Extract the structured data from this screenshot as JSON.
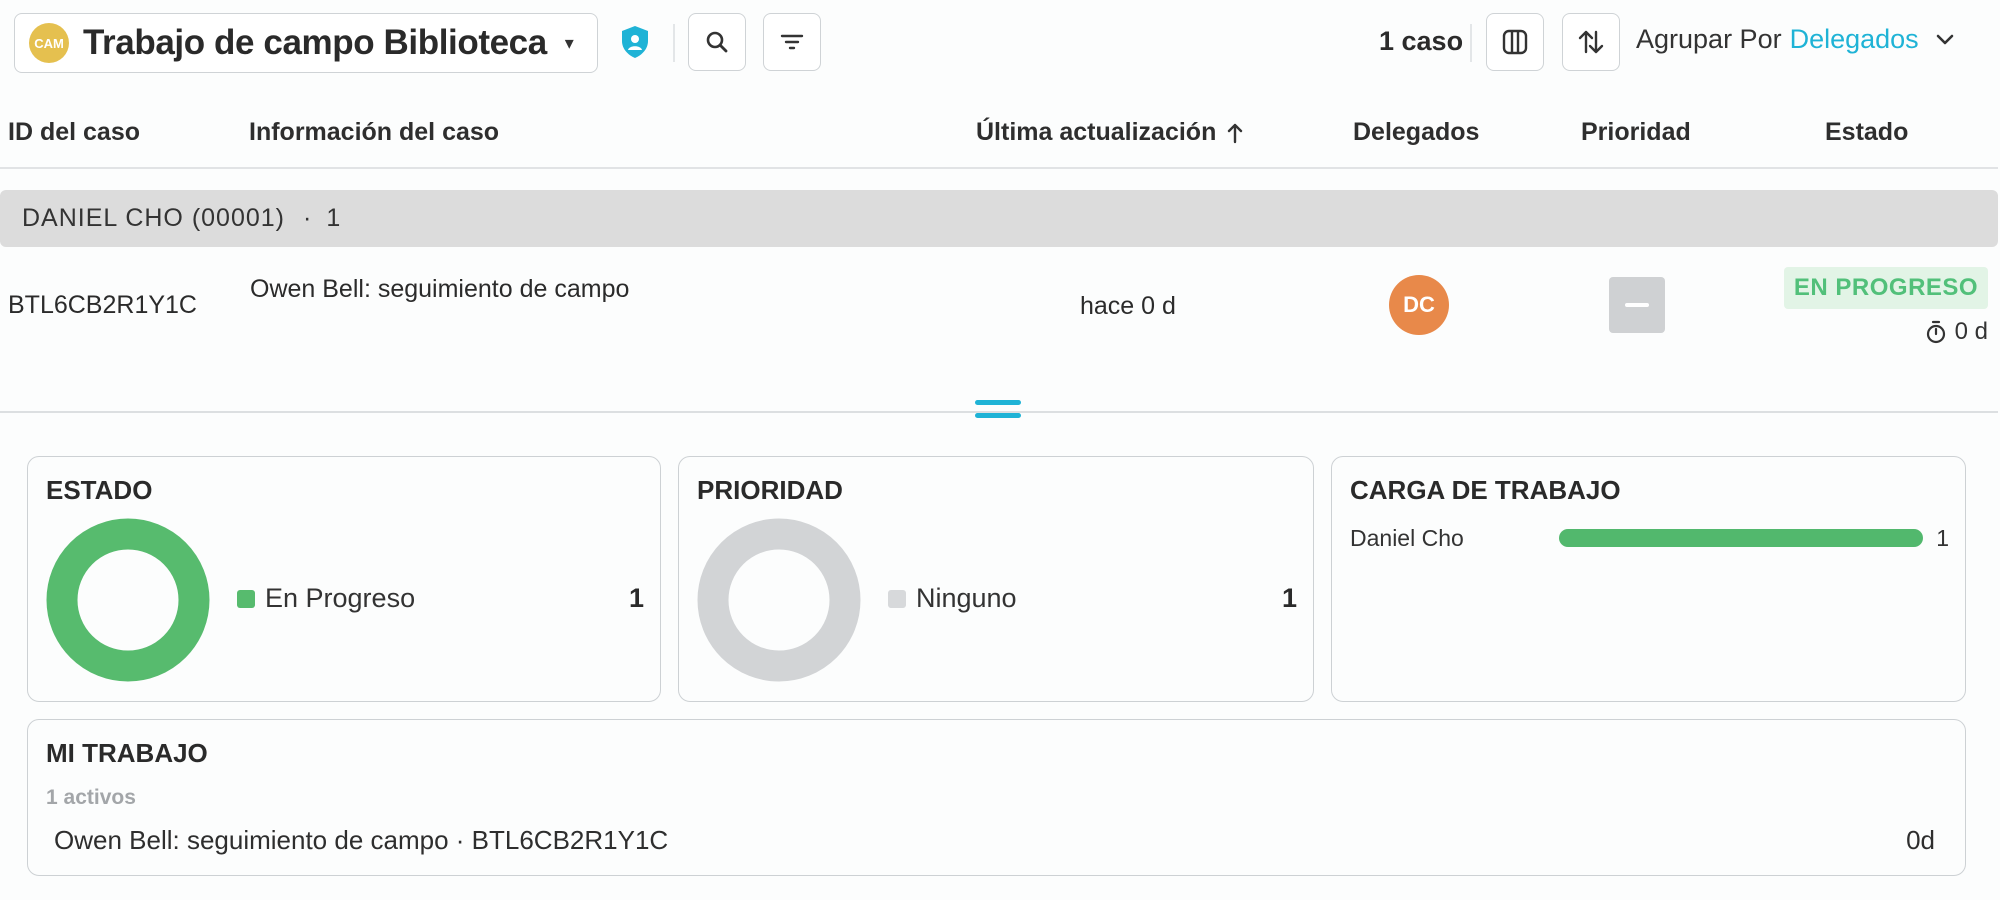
{
  "toolbar": {
    "project_avatar": "CAM",
    "project_title": "Trabajo de campo Biblioteca",
    "case_count": "1 caso",
    "group_by_label": "Agrupar Por",
    "group_by_value": "Delegados",
    "accent_color": "#1fb3d6"
  },
  "table": {
    "headers": {
      "id": "ID del caso",
      "info": "Información del caso",
      "updated": "Última actualización",
      "assignees": "Delegados",
      "priority": "Prioridad",
      "status": "Estado"
    },
    "sort_icon": "arrow-up-icon",
    "group": {
      "label": "DANIEL CHO (00001)",
      "separator": "·",
      "count": "1"
    },
    "rows": [
      {
        "id": "BTL6CB2R1Y1C",
        "info": "Owen Bell: seguimiento de campo",
        "updated": "hace 0 d",
        "assignee_initials": "DC",
        "priority": "—",
        "status": "EN PROGRESO",
        "timer": "0 d"
      }
    ]
  },
  "cards": {
    "estado": {
      "title": "ESTADO",
      "legend_label": "En Progreso",
      "legend_count": "1",
      "color": "#57bb6e"
    },
    "prioridad": {
      "title": "PRIORIDAD",
      "legend_label": "Ninguno",
      "legend_count": "1",
      "color": "#d2d4d6"
    },
    "carga": {
      "title": "CARGA DE TRABAJO",
      "rows": [
        {
          "name": "Daniel Cho",
          "count": "1",
          "fraction": 1.0
        }
      ],
      "color": "#52b86d"
    },
    "mi_trabajo": {
      "title": "MI TRABAJO",
      "subtitle": "1 activos",
      "item": "Owen Bell: seguimiento de campo · BTL6CB2R1Y1C",
      "age": "0d"
    }
  }
}
